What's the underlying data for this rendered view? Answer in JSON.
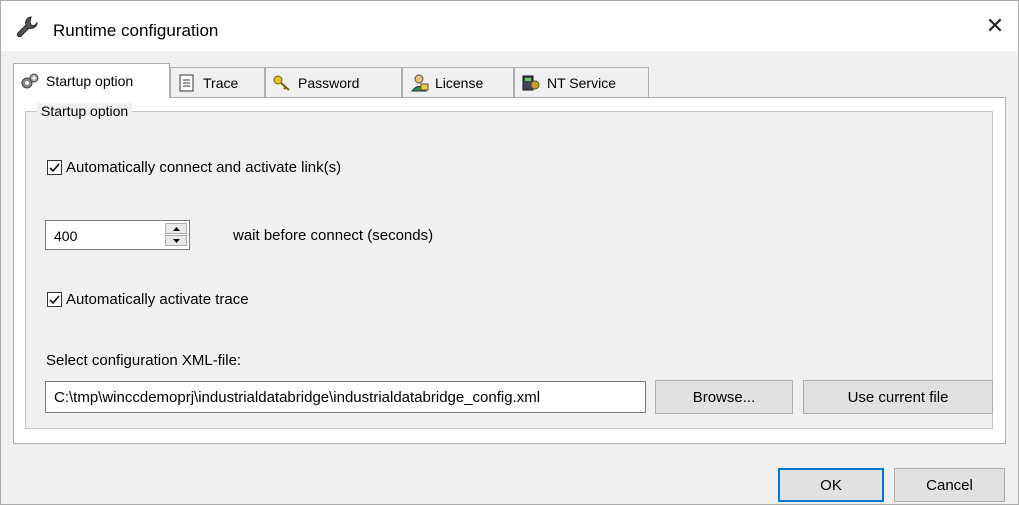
{
  "window": {
    "title": "Runtime configuration",
    "close_glyph": "✕"
  },
  "tabs": [
    {
      "label": "Startup option",
      "icon": "gears-icon"
    },
    {
      "label": "Trace",
      "icon": "notepad-icon"
    },
    {
      "label": "Password",
      "icon": "keys-icon"
    },
    {
      "label": "License",
      "icon": "license-user-icon"
    },
    {
      "label": "NT Service",
      "icon": "service-icon"
    }
  ],
  "group": {
    "title": "Startup option"
  },
  "options": {
    "auto_connect_label": "Automatically connect and activate link(s)",
    "auto_connect_checked": true,
    "wait_value": "400",
    "wait_label": "wait before connect (seconds)",
    "auto_trace_label": "Automatically activate trace",
    "auto_trace_checked": true
  },
  "config": {
    "label": "Select configuration XML-file:",
    "path": "C:\\tmp\\winccdemoprj\\industrialdatabridge\\industrialdatabridge_config.xml",
    "browse_label": "Browse...",
    "use_current_label": "Use current file"
  },
  "footer": {
    "ok_label": "OK",
    "cancel_label": "Cancel"
  },
  "colors": {
    "accent": "#0078d7",
    "face": "#f0f0f0",
    "border": "#adadad"
  }
}
